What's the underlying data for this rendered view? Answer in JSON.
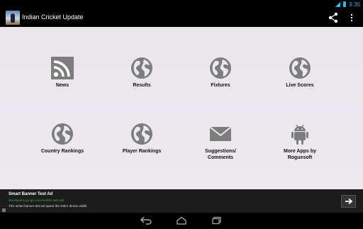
{
  "status_bar": {
    "time": "9:30",
    "accent": "#33b5e5"
  },
  "action_bar": {
    "title": "Indian Cricket Update",
    "icons": [
      "app-icon",
      "share-icon",
      "overflow-menu-icon"
    ]
  },
  "tiles": [
    {
      "label": "News",
      "icon": "rss-icon"
    },
    {
      "label": "Results",
      "icon": "globe-icon"
    },
    {
      "label": "Fixtures",
      "icon": "globe-icon"
    },
    {
      "label": "Live Scores",
      "icon": "globe-icon"
    },
    {
      "label": "Country Rankings",
      "icon": "globe-icon"
    },
    {
      "label": "Player Rankings",
      "icon": "globe-icon"
    },
    {
      "label": "Suggestions/ Comments",
      "icon": "mail-icon"
    },
    {
      "label": "More Apps by Roguesoft",
      "icon": "android-icon"
    }
  ],
  "ad": {
    "title": "Smart Banner Test Ad",
    "url": "developers.google.com/mobile-ads-sdk",
    "description": "This smart banner test ad spans the entire device width."
  },
  "nav": {
    "icons": [
      "back-icon",
      "home-icon",
      "recents-icon"
    ]
  },
  "colors": {
    "content_bg": "#ebe8ee",
    "icon_gray": "#7d7d7d",
    "ad_link": "#3aa848"
  }
}
